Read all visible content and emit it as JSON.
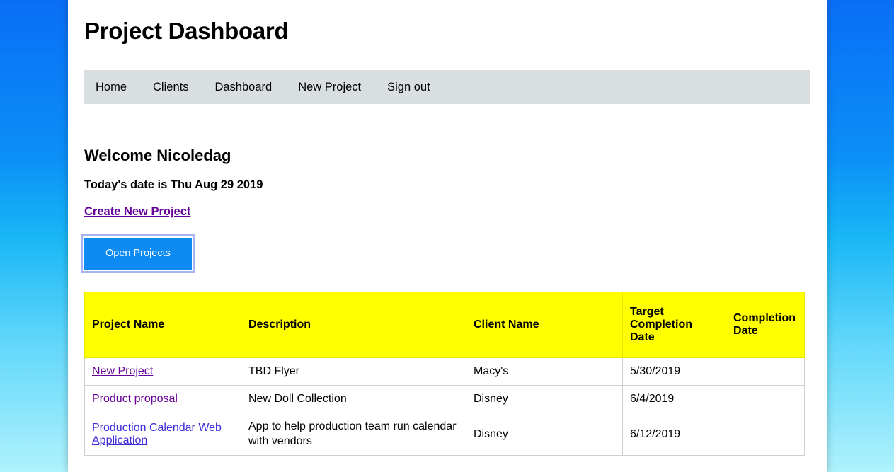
{
  "page": {
    "title": "Project Dashboard",
    "background_top_color": "#0a6ef5",
    "background_bottom_color": "#aff2fc"
  },
  "nav": {
    "items": [
      {
        "label": "Home"
      },
      {
        "label": "Clients"
      },
      {
        "label": "Dashboard"
      },
      {
        "label": "New Project"
      },
      {
        "label": "Sign out"
      }
    ]
  },
  "welcome": {
    "heading": "Welcome Nicoledag",
    "today": "Today's date is Thu Aug 29 2019",
    "create_project_link": "Create New Project"
  },
  "actions": {
    "open_projects_label": "Open Projects",
    "button_color": "#0d8bf2",
    "focus_ring_color": "#a5b4f4"
  },
  "projects_table": {
    "header_color": "#ffff00",
    "columns": [
      "Project Name",
      "Description",
      "Client Name",
      "Target Completion Date",
      "Completion Date"
    ],
    "rows": [
      {
        "name": "New Project",
        "name_state": "visited",
        "description": "TBD Flyer",
        "client": "Macy's",
        "target_completion_date": "5/30/2019",
        "completion_date": ""
      },
      {
        "name": "Product proposal",
        "name_state": "visited",
        "description": "New Doll Collection",
        "client": "Disney",
        "target_completion_date": "6/4/2019",
        "completion_date": ""
      },
      {
        "name": "Production Calendar Web Application",
        "name_state": "unvisited",
        "description": "App to help production team run calendar with vendors",
        "client": "Disney",
        "target_completion_date": "6/12/2019",
        "completion_date": ""
      }
    ]
  }
}
